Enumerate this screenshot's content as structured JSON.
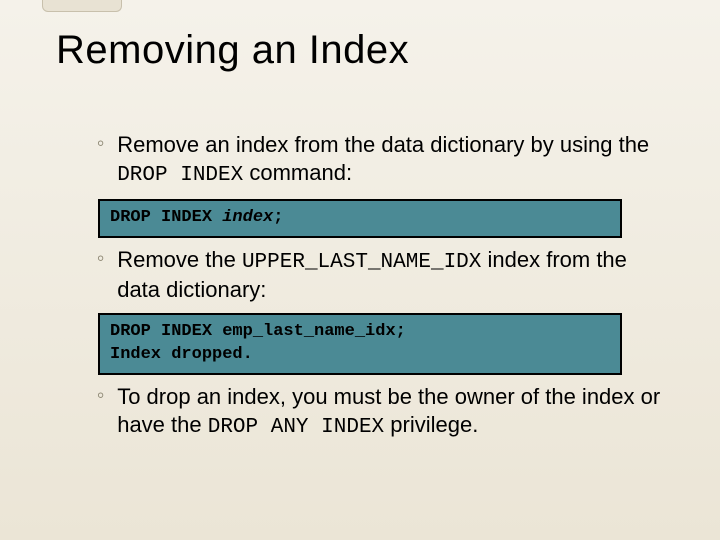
{
  "title": "Removing an Index",
  "bullets": {
    "b1_pre": "Remove an index from the data dictionary by using the ",
    "b1_code": "DROP INDEX",
    "b1_post": " command:",
    "b2_pre": "Remove the ",
    "b2_code": "UPPER_LAST_NAME_IDX",
    "b2_post": " index from the data dictionary:",
    "b3_pre": "To drop an index, you must be the owner of the index or have the ",
    "b3_code": "DROP ANY INDEX",
    "b3_post": " privilege."
  },
  "code1_a": "DROP INDEX ",
  "code1_b": "index",
  "code1_c": ";",
  "code2_line1": "DROP INDEX emp_last_name_idx;",
  "code2_line2": "Index dropped."
}
